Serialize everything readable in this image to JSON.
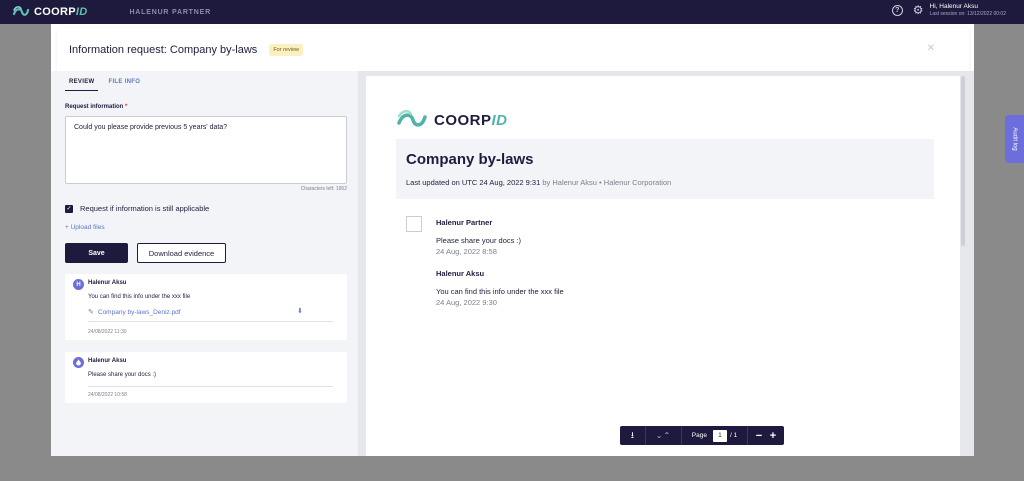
{
  "topbar": {
    "brand_main": "COORP",
    "brand_accent": "ID",
    "partner": "HALENUR PARTNER",
    "help_icon": "question-circle-icon",
    "settings_icon": "gear-icon",
    "user_greeting": "Hi, Halenur Aksu",
    "last_session": "Last session on: 13/12/2022 00:02"
  },
  "audit_tab": {
    "label": "Audit log"
  },
  "modal": {
    "title": "Information request: Company by-laws",
    "badge": "For review",
    "close_icon": "close-icon"
  },
  "left_panel": {
    "tabs": [
      {
        "label": "REVIEW",
        "active": true
      },
      {
        "label": "FILE INFO",
        "active": false
      }
    ],
    "request_label": "Request information",
    "required_mark": "*",
    "request_text": "Could you please provide previous 5 years' data?",
    "characters_left": "Characters left: 1952",
    "checkbox_label": "Request if information is still applicable",
    "checkbox_checked": true,
    "upload_label": "+ Upload files",
    "save_label": "Save",
    "download_label": "Download evidence",
    "comments": [
      {
        "avatar": "H",
        "name": "Halenur Aksu",
        "text": "You can find this info under the xxx file",
        "attachment": "Company by-laws_Deniz.pdf",
        "date": "24/08/2022 11:30"
      },
      {
        "avatar": "",
        "name": "Halenur Aksu",
        "text": "Please share your docs :)",
        "date": "24/08/2022 10:58"
      }
    ]
  },
  "document": {
    "brand_main": "COORP",
    "brand_accent": "ID",
    "title": "Company by-laws",
    "updated_prefix": "Last updated on UTC 24 Aug, 2022 9:31",
    "updated_by": " by Halenur Aksu • Halenur Corporation",
    "messages": [
      {
        "name": "Halenur Partner",
        "text": "Please share your docs :)",
        "date": "24 Aug, 2022 8:58"
      },
      {
        "name": "Halenur Aksu",
        "text": "You can find this info under the xxx file",
        "date": "24 Aug, 2022 9:30"
      }
    ]
  },
  "pdf_toolbar": {
    "download_icon": "download-icon",
    "page_label": "Page",
    "page_current": "1",
    "page_total": "/ 1",
    "zoom_out": "−",
    "zoom_in": "+"
  },
  "colors": {
    "navy": "#1d1a3d",
    "accent_teal": "#5ec2b3",
    "link_blue": "#5b76c8",
    "badge_bg": "#fdf0c0",
    "audit_purple": "#6b6edb"
  }
}
